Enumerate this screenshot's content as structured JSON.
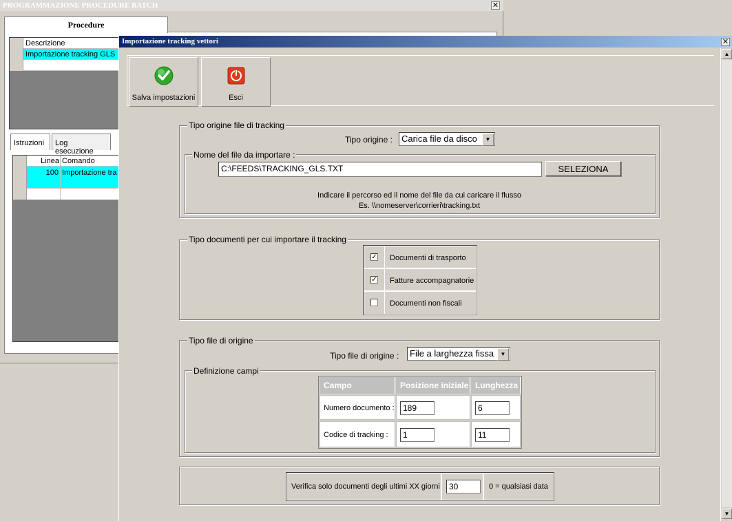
{
  "background_window": {
    "title": "PROGRAMMAZIONE PROCEDURE BATCH",
    "close_glyph": "✕",
    "tab_label": "Procedure",
    "grid1_header": "Descrizione",
    "grid1_row": "Importazione tracking GLS",
    "tabs": [
      "Istruzioni",
      "Log esecuzione"
    ],
    "grid2_header_line": "Linea",
    "grid2_header_cmd": "Comando",
    "grid2_row_line": "100",
    "grid2_row_cmd": "Importazione tra"
  },
  "dialog": {
    "title": "Importazione tracking vettori",
    "close_glyph": "✕",
    "toolbar": {
      "save_label": "Salva impostazioni",
      "exit_label": "Esci"
    },
    "origin_group": {
      "label": "Tipo origine file di tracking",
      "tipo_origine_label": "Tipo origine :",
      "tipo_origine_value": "Carica file da disco",
      "file_group_label": "Nome del file da importare :",
      "file_path": "C:\\FEEDS\\TRACKING_GLS.TXT",
      "select_button": "SELEZIONA",
      "hint_line1": "Indicare il percorso ed il nome del file da cui caricare il flusso",
      "hint_line2": "Es. \\\\nomeserver\\corrieri\\tracking.txt"
    },
    "documents_group": {
      "label": "Tipo documenti per cui importare il tracking",
      "items": [
        {
          "label": "Documenti di trasporto",
          "checked": true,
          "mark": "✓"
        },
        {
          "label": "Fatture accompagnatorie",
          "checked": true,
          "mark": "✓"
        },
        {
          "label": "Documenti non fiscali",
          "checked": false,
          "mark": ""
        }
      ]
    },
    "filetype_group": {
      "label": "Tipo file di origine",
      "tipo_file_label": "Tipo file di origine :",
      "tipo_file_value": "File a larghezza fissa",
      "fields_group_label": "Definizione campi",
      "columns": [
        "Campo",
        "Posizione iniziale",
        "Lunghezza"
      ],
      "rows": [
        {
          "campo": "Numero documento :",
          "posizione": "189",
          "lunghezza": "6"
        },
        {
          "campo": "Codice di tracking :",
          "posizione": "1",
          "lunghezza": "11"
        }
      ]
    },
    "verify": {
      "label": "Verifica solo documenti degli ultimi XX giorni :",
      "value": "30",
      "note": "0 = qualsiasi data"
    }
  },
  "colors": {
    "title_gradient_start": "#0a246a",
    "title_gradient_end": "#a6caf0",
    "selected_row": "#00ffff",
    "save_icon": "#2fa82a",
    "exit_icon": "#e03a1e"
  },
  "icons": {
    "save": "check-circle-icon",
    "exit": "power-icon",
    "dropdown": "▼",
    "scroll_up": "▲",
    "scroll_down": "▼"
  }
}
